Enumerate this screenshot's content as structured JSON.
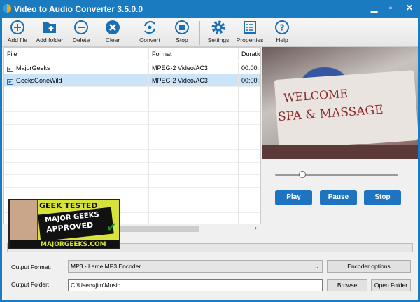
{
  "window": {
    "title": "Video to Audio Converter 3.5.0.0",
    "minimize": "▁",
    "maximize": "▫",
    "close": "✕"
  },
  "toolbar": [
    {
      "label": "Add file",
      "icon": "plus-circle-icon"
    },
    {
      "label": "Add folder",
      "icon": "folder-plus-icon"
    },
    {
      "label": "Delete",
      "icon": "minus-circle-icon"
    },
    {
      "label": "Clear",
      "icon": "x-circle-icon"
    },
    {
      "label": "Convert",
      "icon": "convert-icon"
    },
    {
      "label": "Stop",
      "icon": "stop-circle-icon"
    },
    {
      "label": "Settings",
      "icon": "gear-icon"
    },
    {
      "label": "Properties",
      "icon": "list-icon"
    },
    {
      "label": "Help",
      "icon": "help-icon"
    }
  ],
  "table": {
    "columns": [
      "File",
      "Format",
      "Duratio"
    ],
    "rows": [
      {
        "file": "MajorGeeks",
        "format": "MPEG-2 Video/AC3",
        "duration": "00:00:"
      },
      {
        "file": "GeeksGoneWild",
        "format": "MPEG-2 Video/AC3",
        "duration": "00:00:"
      }
    ]
  },
  "video": {
    "sign1": "WELCOME",
    "sign2": "SPA & MASSAGE"
  },
  "player": {
    "play": "Play",
    "pause": "Pause",
    "stop": "Stop",
    "position": 0.22
  },
  "output": {
    "format_label": "Output Format:",
    "format_value": "MP3 - Lame MP3 Encoder",
    "encoder_options": "Encoder options",
    "folder_label": "Output Folder:",
    "folder_value": "C:\\Users\\jim\\Music",
    "browse": "Browse",
    "open_folder": "Open Folder"
  },
  "badge": {
    "line1": "GEEK TESTED",
    "line2": "MAJOR GEEKS",
    "line3": "APPROVED",
    "line4": "MAJORGEEKS.COM"
  }
}
